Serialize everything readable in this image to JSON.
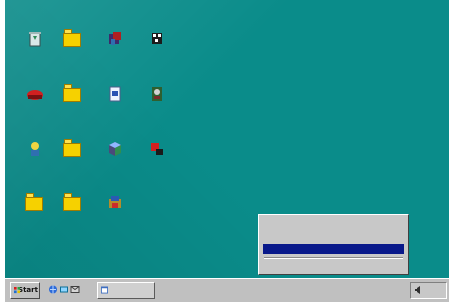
{
  "desktop": {
    "background_color": "#0a8c8a",
    "icons": [
      {
        "label": "",
        "icon": "recycle-bin-icon"
      },
      {
        "label": "",
        "icon": "folder-icon"
      },
      {
        "label": "",
        "icon": "program-icon"
      },
      {
        "label": "",
        "icon": "game-icon"
      },
      {
        "label": "",
        "icon": "mail-icon"
      },
      {
        "label": "",
        "icon": "folder-icon"
      },
      {
        "label": "",
        "icon": "document-icon"
      },
      {
        "label": "",
        "icon": "application-icon"
      },
      {
        "label": "",
        "icon": "network-icon"
      },
      {
        "label": "",
        "icon": "folder-icon"
      },
      {
        "label": "",
        "icon": "cube-icon"
      },
      {
        "label": "",
        "icon": "tool-icon"
      },
      {
        "label": "",
        "icon": "folder-icon"
      },
      {
        "label": "",
        "icon": "folder-icon"
      },
      {
        "label": "",
        "icon": "installer-icon"
      }
    ]
  },
  "taskbar": {
    "start_label": "Start",
    "task_label": "",
    "clock": ""
  },
  "context_menu": {
    "items": [
      "",
      "",
      "",
      "",
      ""
    ],
    "selected_index": 2
  },
  "colors": {
    "desktop": "#0a8c8a",
    "taskbar": "#c0c0c0",
    "menu_selected": "#08188a"
  }
}
